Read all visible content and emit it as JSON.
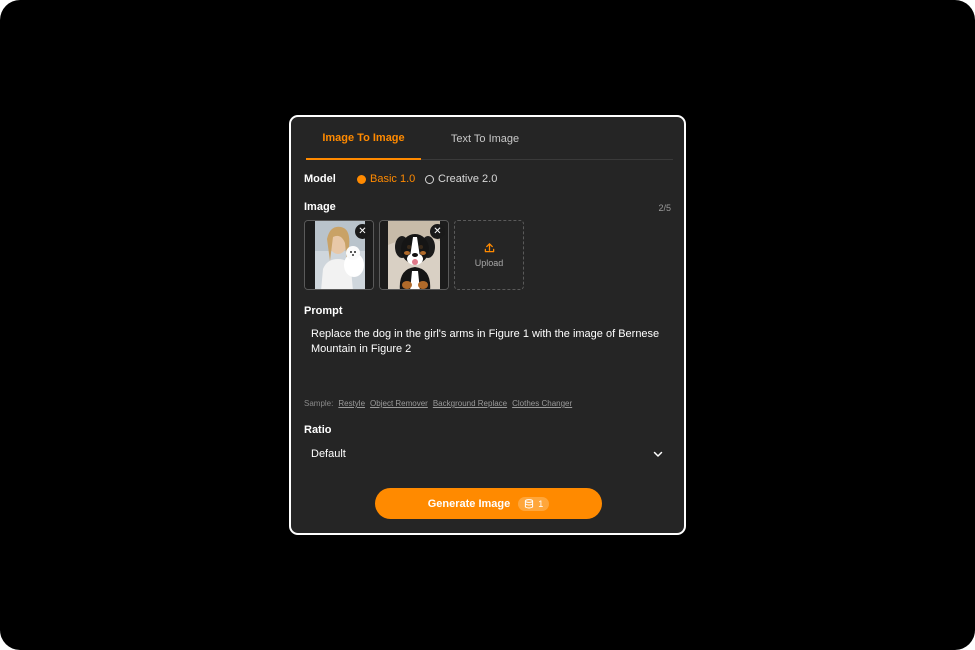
{
  "tabs": [
    {
      "label": "Image To Image",
      "active": true
    },
    {
      "label": "Text To Image",
      "active": false
    }
  ],
  "model": {
    "label": "Model",
    "options": [
      {
        "label": "Basic 1.0",
        "selected": true
      },
      {
        "label": "Creative 2.0",
        "selected": false
      }
    ]
  },
  "image": {
    "label": "Image",
    "count": "2/5",
    "upload_label": "Upload"
  },
  "prompt": {
    "label": "Prompt",
    "value": "Replace the dog in the girl's arms in Figure 1 with the image of Bernese Mountain in Figure 2"
  },
  "samples": {
    "label": "Sample:",
    "items": [
      "Restyle",
      "Object Remover",
      "Background Replace",
      "Clothes Changer"
    ]
  },
  "ratio": {
    "label": "Ratio",
    "value": "Default"
  },
  "generate": {
    "label": "Generate Image",
    "credits": "1"
  },
  "colors": {
    "accent": "#ff8a00",
    "panel_bg": "#252525",
    "page_bg": "#000000"
  }
}
